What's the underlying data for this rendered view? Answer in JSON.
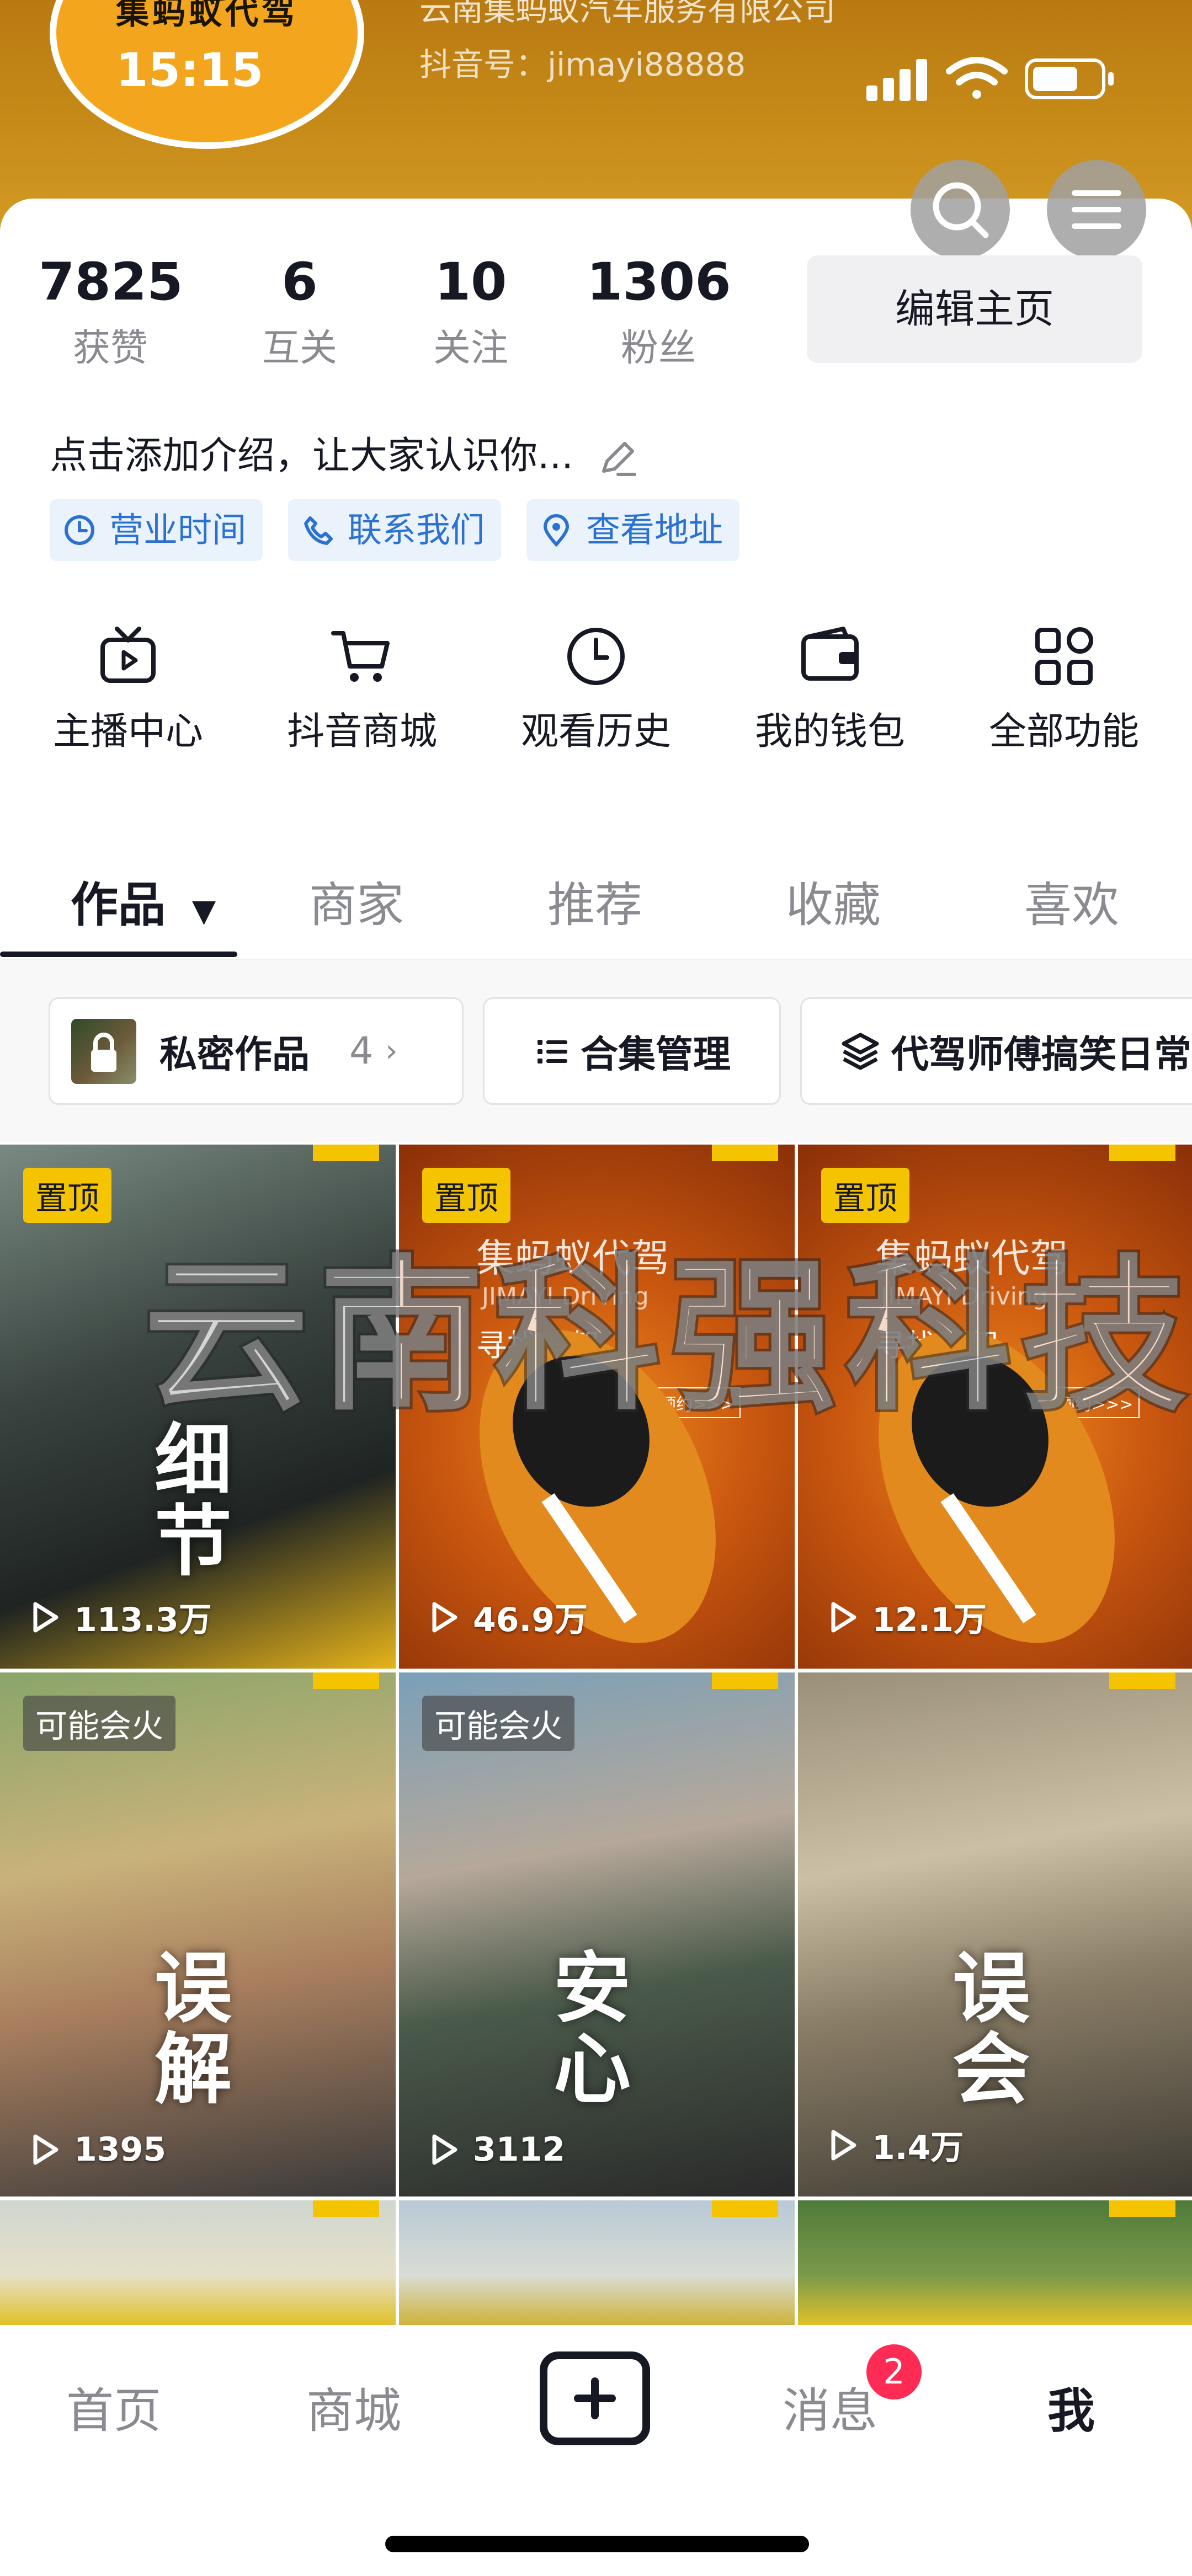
{
  "status_bar": {
    "time": "15:15"
  },
  "profile": {
    "avatar_text": "集蚂蚁代驾",
    "company": "云南集蚂蚁汽车服务有限公司",
    "douyin_id": "抖音号：jimayi88888",
    "bio_placeholder": "点击添加介绍，让大家认识你..."
  },
  "stats": [
    {
      "value": "7825",
      "label": "获赞"
    },
    {
      "value": "6",
      "label": "互关"
    },
    {
      "value": "10",
      "label": "关注"
    },
    {
      "value": "1306",
      "label": "粉丝"
    }
  ],
  "edit_button": "编辑主页",
  "tags": [
    {
      "label": "营业时间",
      "icon": "clock-icon"
    },
    {
      "label": "联系我们",
      "icon": "phone-icon"
    },
    {
      "label": "查看地址",
      "icon": "location-pin-icon"
    }
  ],
  "functions": [
    {
      "label": "主播中心",
      "icon": "tv-icon"
    },
    {
      "label": "抖音商城",
      "icon": "cart-icon"
    },
    {
      "label": "观看历史",
      "icon": "clock-icon"
    },
    {
      "label": "我的钱包",
      "icon": "wallet-icon"
    },
    {
      "label": "全部功能",
      "icon": "apps-grid-icon"
    }
  ],
  "tabs": [
    {
      "label": "作品",
      "active": true
    },
    {
      "label": "商家"
    },
    {
      "label": "推荐"
    },
    {
      "label": "收藏"
    },
    {
      "label": "喜欢"
    }
  ],
  "filters": {
    "private_works": {
      "label": "私密作品",
      "count": "4"
    },
    "collection": {
      "label": "合集管理"
    },
    "playlist": {
      "label": "代驾师傅搞笑日常"
    }
  },
  "watermark": "云南科强科技",
  "videos": [
    {
      "badge": "置顶",
      "plays": "113.3万",
      "caption": "细节"
    },
    {
      "badge": "置顶",
      "plays": "46.9万",
      "caption": ""
    },
    {
      "badge": "置顶",
      "plays": "12.1万",
      "caption": ""
    },
    {
      "badge": "可能会火",
      "plays": "1395",
      "caption": "误解"
    },
    {
      "badge": "可能会火",
      "plays": "3112",
      "caption": "安心"
    },
    {
      "badge": "",
      "plays": "1.4万",
      "caption": "误会"
    }
  ],
  "poster_text": {
    "brand": "集蚂蚁代驾",
    "latin": "JIMAYI Driving",
    "slogan": "寻找代驾",
    "cta": "立即预约>>>"
  },
  "bottom_nav": [
    {
      "label": "首页"
    },
    {
      "label": "商城"
    },
    {
      "label": ""
    },
    {
      "label": "消息",
      "badge": "2"
    },
    {
      "label": "我",
      "active": true
    }
  ],
  "colors": {
    "header": "#c78b18",
    "accent_yellow": "#f5c400",
    "link_blue": "#2b71d0",
    "badge_red": "#fe2c55"
  }
}
